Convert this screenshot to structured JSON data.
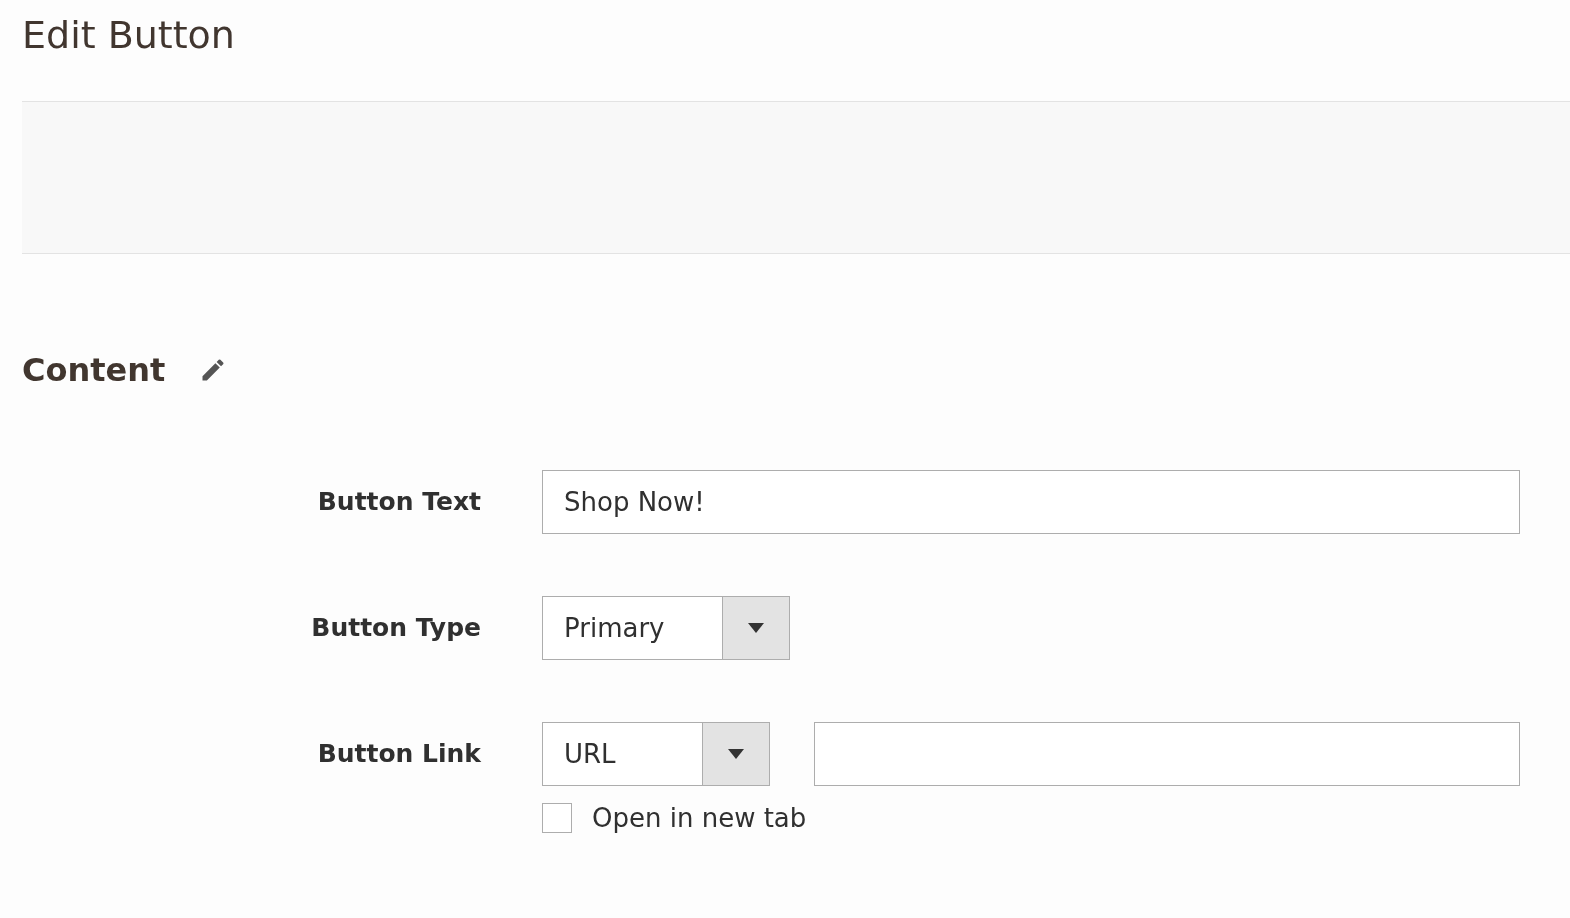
{
  "title": "Edit Button",
  "section": {
    "title": "Content"
  },
  "fields": [
    {
      "kind": "text",
      "label": "Button Text",
      "value": "Shop Now!"
    },
    {
      "kind": "select",
      "label": "Button Type",
      "value": "Primary"
    },
    {
      "kind": "select-input",
      "label": "Button Link",
      "value": "URL",
      "checkbox": {
        "label": "Open in new tab",
        "checked": false
      }
    }
  ]
}
